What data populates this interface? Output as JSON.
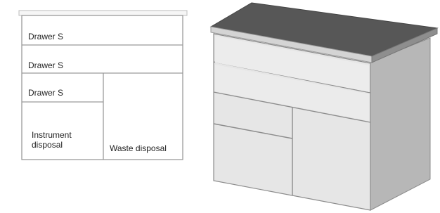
{
  "plan": {
    "labels": {
      "drawer_top": "Drawer S",
      "drawer_middle": "Drawer S",
      "drawer_small": "Drawer S",
      "instrument_disposal": "Instrument disposal",
      "waste_disposal": "Waste disposal"
    }
  },
  "colors": {
    "outline": "#9a9a9a",
    "countertop": "#555555",
    "cabinet_front": "#e6e6e6",
    "cabinet_side": "#b7b7b7"
  }
}
